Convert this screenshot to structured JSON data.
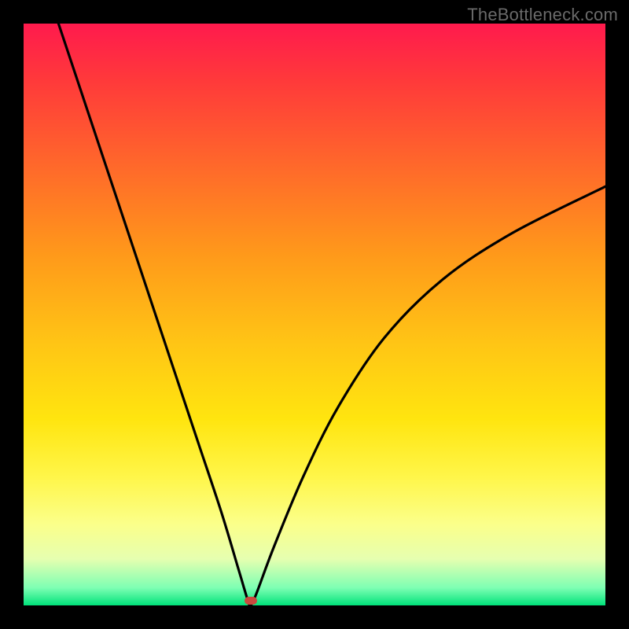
{
  "credit_text": "TheBottleneck.com",
  "chart_data": {
    "type": "line",
    "title": "",
    "xlabel": "",
    "ylabel": "",
    "xlim": [
      0,
      100
    ],
    "ylim": [
      0,
      100
    ],
    "series": [
      {
        "name": "bottleneck-curve",
        "x": [
          6,
          10,
          14,
          18,
          22,
          26,
          30,
          34,
          37,
          38.5,
          39,
          40,
          43,
          48,
          54,
          62,
          72,
          84,
          100
        ],
        "values": [
          100,
          88,
          76,
          64,
          52,
          40,
          28,
          16,
          6,
          1,
          0,
          2,
          10,
          22,
          34,
          46,
          56,
          64,
          72
        ]
      }
    ],
    "notch": {
      "x": 39,
      "y": 0.8
    },
    "gradient_stops": [
      {
        "pct": 0,
        "color": "#ff1a4d"
      },
      {
        "pct": 25,
        "color": "#ff6a2a"
      },
      {
        "pct": 55,
        "color": "#ffc515"
      },
      {
        "pct": 78,
        "color": "#fff64a"
      },
      {
        "pct": 97,
        "color": "#7dffb3"
      },
      {
        "pct": 100,
        "color": "#00e27a"
      }
    ]
  }
}
